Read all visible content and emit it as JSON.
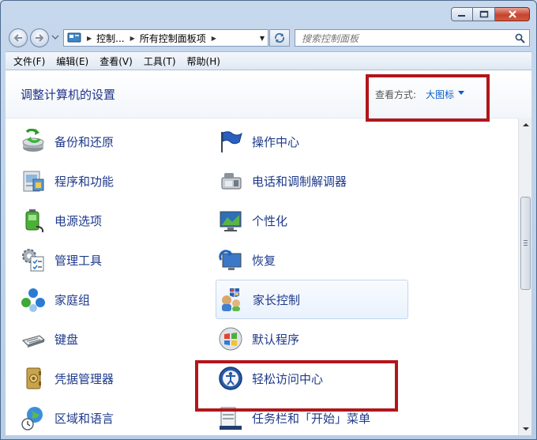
{
  "window": {
    "controls": {
      "minimize": "minimize-icon",
      "maximize": "maximize-icon",
      "close": "close-icon"
    }
  },
  "nav": {
    "breadcrumb": [
      "控制...",
      "所有控制面板项"
    ],
    "search_placeholder": "搜索控制面板"
  },
  "menu": [
    "文件(F)",
    "编辑(E)",
    "查看(V)",
    "工具(T)",
    "帮助(H)"
  ],
  "header": {
    "title": "调整计算机的设置",
    "view_by_label": "查看方式:",
    "view_by_value": "大图标"
  },
  "items_left": [
    {
      "label": "备份和还原",
      "icon": "backup-restore-icon"
    },
    {
      "label": "程序和功能",
      "icon": "programs-features-icon"
    },
    {
      "label": "电源选项",
      "icon": "power-options-icon"
    },
    {
      "label": "管理工具",
      "icon": "admin-tools-icon"
    },
    {
      "label": "家庭组",
      "icon": "homegroup-icon"
    },
    {
      "label": "键盘",
      "icon": "keyboard-icon"
    },
    {
      "label": "凭据管理器",
      "icon": "credential-manager-icon"
    },
    {
      "label": "区域和语言",
      "icon": "region-language-icon"
    }
  ],
  "items_right": [
    {
      "label": "操作中心",
      "icon": "action-center-flag-icon"
    },
    {
      "label": "电话和调制解调器",
      "icon": "phone-modem-icon"
    },
    {
      "label": "个性化",
      "icon": "personalization-icon"
    },
    {
      "label": "恢复",
      "icon": "recovery-icon"
    },
    {
      "label": "家长控制",
      "icon": "parental-controls-icon"
    },
    {
      "label": "默认程序",
      "icon": "default-programs-icon"
    },
    {
      "label": "轻松访问中心",
      "icon": "ease-of-access-icon"
    },
    {
      "label": "任务栏和「开始」菜单",
      "icon": "taskbar-start-menu-icon"
    }
  ],
  "colors": {
    "link": "#1e3a8a",
    "title": "#1e3287",
    "highlight": "#b1161b",
    "view_link": "#0b5ec9"
  }
}
